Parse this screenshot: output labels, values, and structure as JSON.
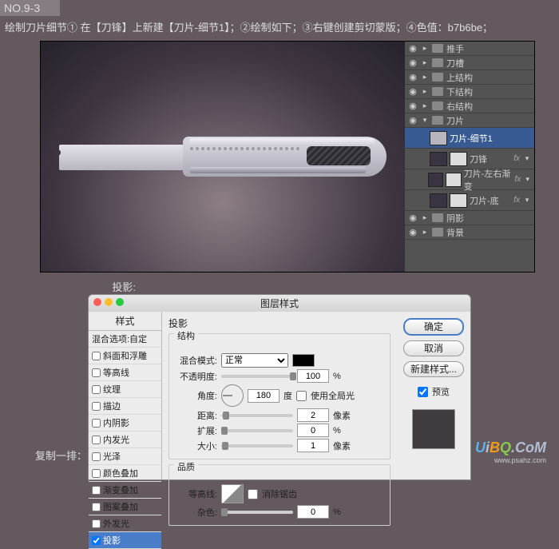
{
  "header": {
    "step_number": "NO.9-3"
  },
  "instruction": "绘制刀片细节① 在【刀锋】上新建【刀片-细节1】；②绘制如下；③右键创建剪切蒙版；④色值：b7b6be；",
  "layers": {
    "items": [
      {
        "label": "推手",
        "type": "folder"
      },
      {
        "label": "刀槽",
        "type": "folder"
      },
      {
        "label": "上结构",
        "type": "folder"
      },
      {
        "label": "下结构",
        "type": "folder"
      },
      {
        "label": "右结构",
        "type": "folder"
      },
      {
        "label": "刀片",
        "type": "folder-open"
      },
      {
        "label": "刀片-细节1",
        "type": "layer",
        "selected": true
      },
      {
        "label": "刀锋",
        "type": "layer",
        "fx": "fx"
      },
      {
        "label": "刀片-左右渐变",
        "type": "layer",
        "fx": "fx"
      },
      {
        "label": "刀片-底",
        "type": "layer",
        "fx": "fx"
      },
      {
        "label": "阴影",
        "type": "folder"
      },
      {
        "label": "背景",
        "type": "folder"
      }
    ]
  },
  "labels": {
    "projection": "投影:",
    "duplicate_row": "复制一排："
  },
  "dialog": {
    "title": "图层样式",
    "styles": {
      "header": "样式",
      "items": [
        "混合选项:自定",
        "斜面和浮雕",
        "等高线",
        "纹理",
        "描边",
        "内阴影",
        "内发光",
        "光泽",
        "颜色叠加",
        "渐变叠加",
        "图案叠加",
        "外发光",
        "投影"
      ]
    },
    "fx": {
      "heading": "投影",
      "group_struct": "结构",
      "group_quality": "品质",
      "blend_mode_label": "混合模式:",
      "blend_mode_value": "正常",
      "opacity_label": "不透明度:",
      "opacity_value": "100",
      "angle_label": "角度:",
      "angle_value": "180",
      "angle_unit": "度",
      "global_light": "使用全局光",
      "distance_label": "距离:",
      "distance_value": "2",
      "px": "像素",
      "spread_label": "扩展:",
      "spread_value": "0",
      "percent": "%",
      "size_label": "大小:",
      "size_value": "1",
      "contour_label": "等高线:",
      "antialias": "消除锯齿",
      "noise_label": "杂色:",
      "noise_value": "0"
    },
    "buttons": {
      "ok": "确定",
      "cancel": "取消",
      "new_style": "新建样式...",
      "preview": "预览"
    }
  },
  "watermark": {
    "text_parts": [
      "U",
      "i",
      "B",
      "Q",
      ".",
      "C",
      "o",
      "M"
    ],
    "sub": "www.psahz.com"
  }
}
